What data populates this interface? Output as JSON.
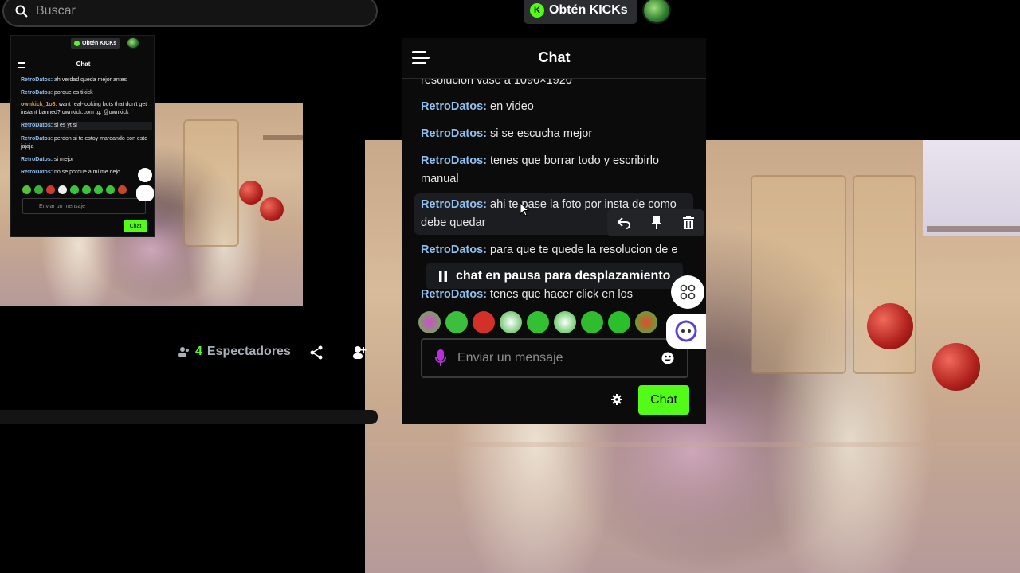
{
  "search": {
    "placeholder": "Buscar"
  },
  "header": {
    "kicks_label": "Obtén KICKs",
    "kick_logo": "K"
  },
  "chat": {
    "title": "Chat",
    "messages": [
      {
        "user": "",
        "text": "resolucion vase a 1090×1920"
      },
      {
        "user": "RetroDatos:",
        "text": " en video"
      },
      {
        "user": "RetroDatos:",
        "text": " si se escucha mejor"
      },
      {
        "user": "RetroDatos:",
        "text": " tenes que borrar todo y escribirlo manual"
      },
      {
        "user": "RetroDatos:",
        "text": " ahi te pase la foto por insta de como debe quedar"
      },
      {
        "user": "RetroDatos:",
        "text": " para que te quede la resolucion de e"
      },
      {
        "user": "RetroDatos:",
        "text": " tenes que hacer click en los"
      }
    ],
    "pause_label": "chat en pausa para desplazamiento",
    "input_placeholder": "Enviar un mensaje",
    "send_label": "Chat"
  },
  "mini_chat": {
    "kicks_label": "Obtén KICKs",
    "title": "Chat",
    "messages": [
      {
        "user": "RetroDatos:",
        "text": " ah verdad queda mejor antes"
      },
      {
        "user": "RetroDatos:",
        "text": " porque es tikick"
      },
      {
        "user": "ownkick_1o8:",
        "text": " want real-looking bots that don't get instant banned? ownkick.com tg: @ownkick"
      },
      {
        "user": "RetroDatos:",
        "text": " si es yt si"
      },
      {
        "user": "RetroDatos:",
        "text": " perdon si te estoy mareando con esto jajaja"
      },
      {
        "user": "RetroDatos:",
        "text": " si mejor"
      },
      {
        "user": "RetroDatos:",
        "text": " no se porque a mi me dejo"
      }
    ],
    "input_placeholder": "Enviar un mensaje",
    "send_label": "Chat"
  },
  "stream": {
    "viewer_count": "4",
    "viewer_label": " Espectadores"
  },
  "colors": {
    "accent": "#53fc18",
    "username": "#8fc0ee",
    "panel": "#0b0b0c"
  }
}
